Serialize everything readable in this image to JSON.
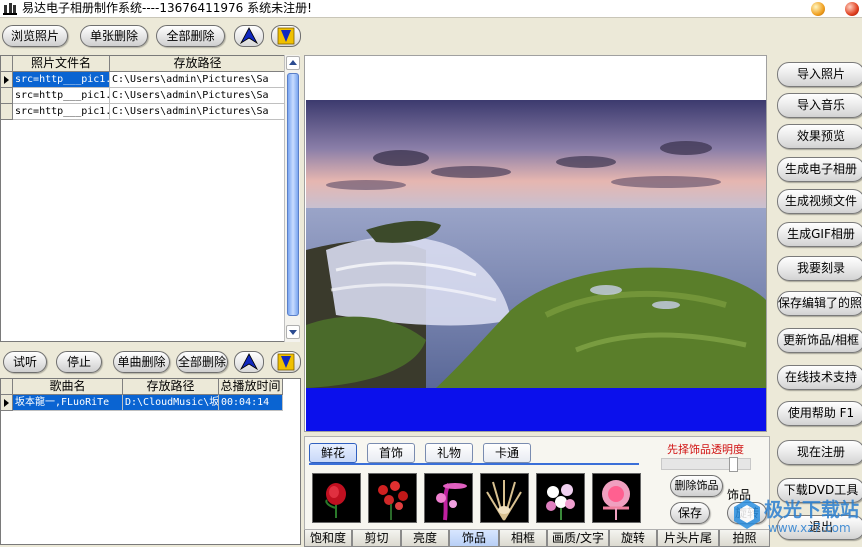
{
  "window": {
    "title": "易达电子相册制作系统----13676411976  系统未注册!"
  },
  "photo_toolbar": {
    "browse": "浏览照片",
    "delete_one": "单张删除",
    "delete_all": "全部删除"
  },
  "photo_table": {
    "columns": [
      "照片文件名",
      "存放路径"
    ],
    "rows": [
      [
        "src=http___pic1.",
        "C:\\Users\\admin\\Pictures\\Sa"
      ],
      [
        "src=http___pic1.",
        "C:\\Users\\admin\\Pictures\\Sa"
      ],
      [
        "src=http___pic1.",
        "C:\\Users\\admin\\Pictures\\Sa"
      ]
    ]
  },
  "music_toolbar": {
    "preview": "试听",
    "stop": "停止",
    "delete_one": "单曲删除",
    "delete_all": "全部删除"
  },
  "music_table": {
    "columns": [
      "歌曲名",
      "存放路径",
      "总播放时间"
    ],
    "rows": [
      [
        "坂本龍一,FLuoRiTe",
        "D:\\CloudMusic\\坂",
        "00:04:14"
      ]
    ]
  },
  "deco": {
    "tabs": [
      "鲜花",
      "首饰",
      "礼物",
      "卡通"
    ],
    "opacity_label": "先择饰品透明度",
    "opacity": 0.85,
    "delete_button": "删除饰品",
    "save_button": "保存",
    "rotate_button": "旋转",
    "side_label": "饰品"
  },
  "bottom_tabs": [
    "饱和度",
    "剪切",
    "亮度",
    "饰品",
    "相框",
    "画质/文字",
    "旋转",
    "片头片尾",
    "拍照"
  ],
  "right_buttons": [
    "导入照片",
    "导入音乐",
    "效果预览",
    "生成电子相册",
    "生成视频文件",
    "生成GIF相册",
    "我要刻录",
    "保存编辑了的照片",
    "更新饰品/相框",
    "在线技术支持",
    "使用帮助  F1",
    "现在注册",
    "下载DVD工具",
    "退出"
  ],
  "watermark": {
    "text": "极光下载站",
    "url": "www.xz7.com"
  },
  "colors": {
    "selection": "#0a64d2",
    "preview_blue": "#0b10ec",
    "accent_red": "#d01010"
  },
  "icons": [
    "up-arrow-icon",
    "down-arrow-icon",
    "app-icon"
  ]
}
